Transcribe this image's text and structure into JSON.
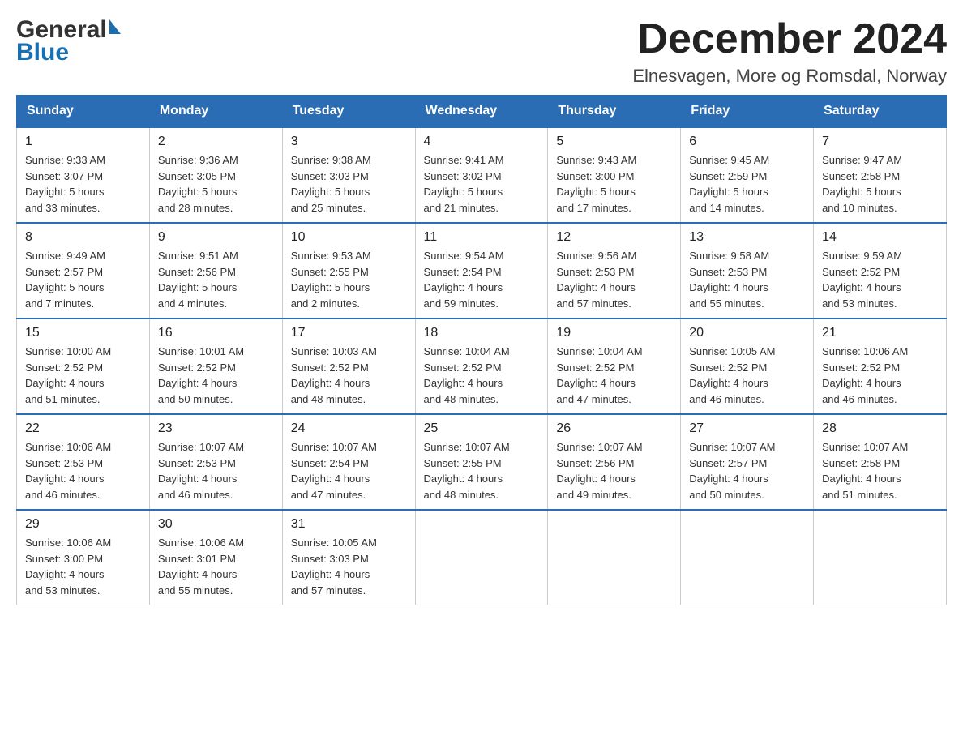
{
  "header": {
    "month_title": "December 2024",
    "location": "Elnesvagen, More og Romsdal, Norway"
  },
  "logo": {
    "general": "General",
    "blue": "Blue"
  },
  "days_of_week": [
    "Sunday",
    "Monday",
    "Tuesday",
    "Wednesday",
    "Thursday",
    "Friday",
    "Saturday"
  ],
  "weeks": [
    [
      {
        "day": "1",
        "sunrise": "Sunrise: 9:33 AM",
        "sunset": "Sunset: 3:07 PM",
        "daylight": "Daylight: 5 hours",
        "daylight2": "and 33 minutes."
      },
      {
        "day": "2",
        "sunrise": "Sunrise: 9:36 AM",
        "sunset": "Sunset: 3:05 PM",
        "daylight": "Daylight: 5 hours",
        "daylight2": "and 28 minutes."
      },
      {
        "day": "3",
        "sunrise": "Sunrise: 9:38 AM",
        "sunset": "Sunset: 3:03 PM",
        "daylight": "Daylight: 5 hours",
        "daylight2": "and 25 minutes."
      },
      {
        "day": "4",
        "sunrise": "Sunrise: 9:41 AM",
        "sunset": "Sunset: 3:02 PM",
        "daylight": "Daylight: 5 hours",
        "daylight2": "and 21 minutes."
      },
      {
        "day": "5",
        "sunrise": "Sunrise: 9:43 AM",
        "sunset": "Sunset: 3:00 PM",
        "daylight": "Daylight: 5 hours",
        "daylight2": "and 17 minutes."
      },
      {
        "day": "6",
        "sunrise": "Sunrise: 9:45 AM",
        "sunset": "Sunset: 2:59 PM",
        "daylight": "Daylight: 5 hours",
        "daylight2": "and 14 minutes."
      },
      {
        "day": "7",
        "sunrise": "Sunrise: 9:47 AM",
        "sunset": "Sunset: 2:58 PM",
        "daylight": "Daylight: 5 hours",
        "daylight2": "and 10 minutes."
      }
    ],
    [
      {
        "day": "8",
        "sunrise": "Sunrise: 9:49 AM",
        "sunset": "Sunset: 2:57 PM",
        "daylight": "Daylight: 5 hours",
        "daylight2": "and 7 minutes."
      },
      {
        "day": "9",
        "sunrise": "Sunrise: 9:51 AM",
        "sunset": "Sunset: 2:56 PM",
        "daylight": "Daylight: 5 hours",
        "daylight2": "and 4 minutes."
      },
      {
        "day": "10",
        "sunrise": "Sunrise: 9:53 AM",
        "sunset": "Sunset: 2:55 PM",
        "daylight": "Daylight: 5 hours",
        "daylight2": "and 2 minutes."
      },
      {
        "day": "11",
        "sunrise": "Sunrise: 9:54 AM",
        "sunset": "Sunset: 2:54 PM",
        "daylight": "Daylight: 4 hours",
        "daylight2": "and 59 minutes."
      },
      {
        "day": "12",
        "sunrise": "Sunrise: 9:56 AM",
        "sunset": "Sunset: 2:53 PM",
        "daylight": "Daylight: 4 hours",
        "daylight2": "and 57 minutes."
      },
      {
        "day": "13",
        "sunrise": "Sunrise: 9:58 AM",
        "sunset": "Sunset: 2:53 PM",
        "daylight": "Daylight: 4 hours",
        "daylight2": "and 55 minutes."
      },
      {
        "day": "14",
        "sunrise": "Sunrise: 9:59 AM",
        "sunset": "Sunset: 2:52 PM",
        "daylight": "Daylight: 4 hours",
        "daylight2": "and 53 minutes."
      }
    ],
    [
      {
        "day": "15",
        "sunrise": "Sunrise: 10:00 AM",
        "sunset": "Sunset: 2:52 PM",
        "daylight": "Daylight: 4 hours",
        "daylight2": "and 51 minutes."
      },
      {
        "day": "16",
        "sunrise": "Sunrise: 10:01 AM",
        "sunset": "Sunset: 2:52 PM",
        "daylight": "Daylight: 4 hours",
        "daylight2": "and 50 minutes."
      },
      {
        "day": "17",
        "sunrise": "Sunrise: 10:03 AM",
        "sunset": "Sunset: 2:52 PM",
        "daylight": "Daylight: 4 hours",
        "daylight2": "and 48 minutes."
      },
      {
        "day": "18",
        "sunrise": "Sunrise: 10:04 AM",
        "sunset": "Sunset: 2:52 PM",
        "daylight": "Daylight: 4 hours",
        "daylight2": "and 48 minutes."
      },
      {
        "day": "19",
        "sunrise": "Sunrise: 10:04 AM",
        "sunset": "Sunset: 2:52 PM",
        "daylight": "Daylight: 4 hours",
        "daylight2": "and 47 minutes."
      },
      {
        "day": "20",
        "sunrise": "Sunrise: 10:05 AM",
        "sunset": "Sunset: 2:52 PM",
        "daylight": "Daylight: 4 hours",
        "daylight2": "and 46 minutes."
      },
      {
        "day": "21",
        "sunrise": "Sunrise: 10:06 AM",
        "sunset": "Sunset: 2:52 PM",
        "daylight": "Daylight: 4 hours",
        "daylight2": "and 46 minutes."
      }
    ],
    [
      {
        "day": "22",
        "sunrise": "Sunrise: 10:06 AM",
        "sunset": "Sunset: 2:53 PM",
        "daylight": "Daylight: 4 hours",
        "daylight2": "and 46 minutes."
      },
      {
        "day": "23",
        "sunrise": "Sunrise: 10:07 AM",
        "sunset": "Sunset: 2:53 PM",
        "daylight": "Daylight: 4 hours",
        "daylight2": "and 46 minutes."
      },
      {
        "day": "24",
        "sunrise": "Sunrise: 10:07 AM",
        "sunset": "Sunset: 2:54 PM",
        "daylight": "Daylight: 4 hours",
        "daylight2": "and 47 minutes."
      },
      {
        "day": "25",
        "sunrise": "Sunrise: 10:07 AM",
        "sunset": "Sunset: 2:55 PM",
        "daylight": "Daylight: 4 hours",
        "daylight2": "and 48 minutes."
      },
      {
        "day": "26",
        "sunrise": "Sunrise: 10:07 AM",
        "sunset": "Sunset: 2:56 PM",
        "daylight": "Daylight: 4 hours",
        "daylight2": "and 49 minutes."
      },
      {
        "day": "27",
        "sunrise": "Sunrise: 10:07 AM",
        "sunset": "Sunset: 2:57 PM",
        "daylight": "Daylight: 4 hours",
        "daylight2": "and 50 minutes."
      },
      {
        "day": "28",
        "sunrise": "Sunrise: 10:07 AM",
        "sunset": "Sunset: 2:58 PM",
        "daylight": "Daylight: 4 hours",
        "daylight2": "and 51 minutes."
      }
    ],
    [
      {
        "day": "29",
        "sunrise": "Sunrise: 10:06 AM",
        "sunset": "Sunset: 3:00 PM",
        "daylight": "Daylight: 4 hours",
        "daylight2": "and 53 minutes."
      },
      {
        "day": "30",
        "sunrise": "Sunrise: 10:06 AM",
        "sunset": "Sunset: 3:01 PM",
        "daylight": "Daylight: 4 hours",
        "daylight2": "and 55 minutes."
      },
      {
        "day": "31",
        "sunrise": "Sunrise: 10:05 AM",
        "sunset": "Sunset: 3:03 PM",
        "daylight": "Daylight: 4 hours",
        "daylight2": "and 57 minutes."
      },
      null,
      null,
      null,
      null
    ]
  ]
}
